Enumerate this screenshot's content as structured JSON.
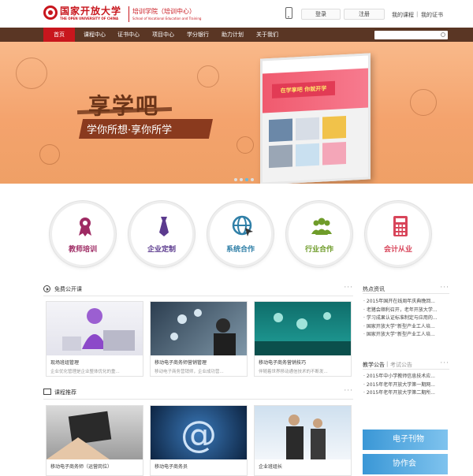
{
  "header": {
    "logo_cn": "国家开放大学",
    "logo_en": "THE OPEN UNIVERSITY OF CHINA",
    "sub_cn": "培训学院（培训中心）",
    "sub_en": "School of Vocational Education and Training",
    "login": "登录",
    "register": "注册",
    "my_courses": "我的课程",
    "separator": "|",
    "my_certs": "我的证书"
  },
  "nav": {
    "items": [
      "首页",
      "课程中心",
      "证书中心",
      "项目中心",
      "学分银行",
      "助力计划",
      "关于我们"
    ]
  },
  "banner": {
    "title": "享学吧",
    "slogan": "学你所想·享你所学",
    "monitor_badge": "在学享吧 你就开学"
  },
  "services": [
    {
      "label": "教师培训",
      "icon": "medal-icon",
      "color": "#9e2a63"
    },
    {
      "label": "企业定制",
      "icon": "tie-icon",
      "color": "#5b3a8e"
    },
    {
      "label": "系统合作",
      "icon": "globe-icon",
      "color": "#2f7fa7"
    },
    {
      "label": "行业合作",
      "icon": "group-icon",
      "color": "#6f9c2a"
    },
    {
      "label": "会计从业",
      "icon": "calculator-icon",
      "color": "#d8455a"
    }
  ],
  "free_courses": {
    "title": "免费公开课",
    "more": "···",
    "cards": [
      {
        "title": "现场班组管理",
        "desc": "企业优化管理是企业整体优化的重..."
      },
      {
        "title": "移动电子商务师营销管理",
        "desc": "移动电子商务营销师，企业成功营..."
      },
      {
        "title": "移动电子商务营销技巧",
        "desc": "伴随着世界移动通信技术的不断发..."
      }
    ]
  },
  "recommend": {
    "title": "课程推荐",
    "more": "···",
    "cards": [
      {
        "title": "移动电子商务师（运营岗位）"
      },
      {
        "title": "移动电子商务员"
      },
      {
        "title": "企业班组长"
      }
    ]
  },
  "hot_news": {
    "title": "热点资讯",
    "more": "···",
    "items": [
      "2015年国开在线周年庆典晚回...",
      "老猪会顺利召开，老年开放大学...",
      "学习成果认证标准制定与应用的...",
      "国家开放大学“新型产业工人培...",
      "国家开放大学“新型产业工人培..."
    ]
  },
  "notice": {
    "title_a": "教学公告",
    "sep": "|",
    "title_b": "考试公告",
    "more": "···",
    "items": [
      "2015年中小学教师信息技术应...",
      "2015年老年开放大学第一期网...",
      "2015年老年开放大学第二期所..."
    ]
  },
  "promos": {
    "ebook": "电子刊物",
    "partner": "协作会"
  }
}
